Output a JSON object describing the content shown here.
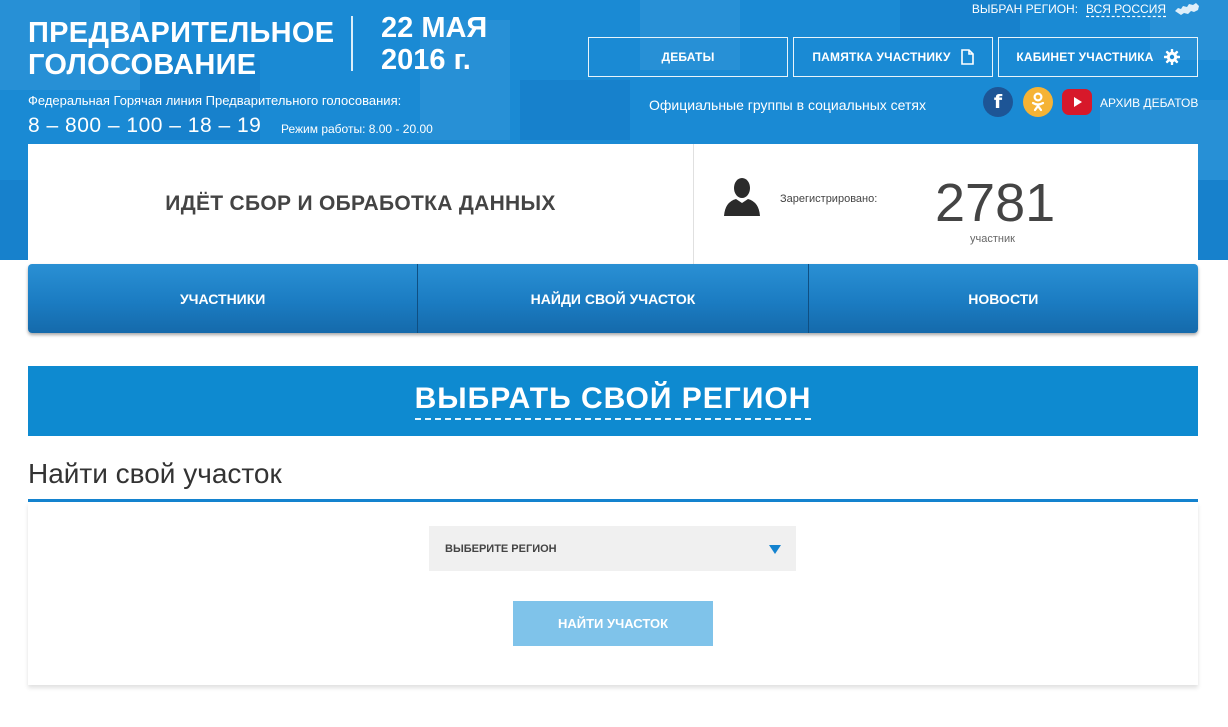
{
  "header": {
    "brand_line1": "ПРЕДВАРИТЕЛЬНОЕ",
    "brand_line2": "ГОЛОСОВАНИЕ",
    "date_line1": "22 МАЯ",
    "date_line2": "2016 г.",
    "hotline_label": "Федеральная Горячая линия Предварительного голосования:",
    "hotline_phone": "8 – 800 – 100 – 18 – 19",
    "hours": "Режим работы: 8.00 - 20.00",
    "region_label": "ВЫБРАН РЕГИОН:",
    "region_value": "ВСЯ РОССИЯ",
    "buttons": {
      "debates": "ДЕБАТЫ",
      "memo": "ПАМЯТКА УЧАСТНИКУ",
      "cabinet": "КАБИНЕТ УЧАСТНИКА"
    },
    "social_label": "Официальные группы в социальных сетях",
    "archive": "АРХИВ ДЕБАТОВ",
    "colors": {
      "background": "#1a8ad4",
      "facebook": "#1d5596",
      "odnoklassniki": "#f5b335",
      "youtube": "#d7182a"
    }
  },
  "status": {
    "text": "ИДЁТ СБОР И ОБРАБОТКА ДАННЫХ",
    "registered_label": "Зарегистрировано:",
    "registered_count": "2781",
    "registered_unit": "участник"
  },
  "nav": {
    "items": [
      "УЧАСТНИКИ",
      "НАЙДИ СВОЙ УЧАСТОК",
      "НОВОСТИ"
    ]
  },
  "region_banner": {
    "label": "ВЫБРАТЬ СВОЙ РЕГИОН"
  },
  "find": {
    "title": "Найти свой участок",
    "select_value": "ВЫБЕРИТЕ РЕГИОН",
    "button": "НАЙТИ УЧАСТОК"
  },
  "icons": {
    "map": "russia-map-icon",
    "memo": "document-icon",
    "cabinet": "gear-icon",
    "user": "user-silhouette-icon",
    "select": "chevron-down-icon"
  }
}
